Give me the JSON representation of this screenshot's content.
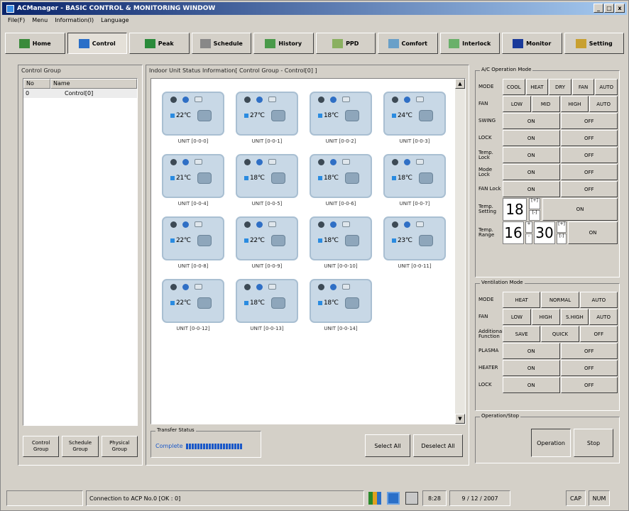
{
  "title": "ACManager - BASIC CONTROL & MONITORING WINDOW",
  "window_buttons": [
    "_",
    "□",
    "x"
  ],
  "menu": [
    "File(F)",
    "Menu",
    "Information(I)",
    "Language"
  ],
  "toolbar": [
    {
      "label": "Home",
      "icon": "home-icon",
      "color": "#3a8a3a"
    },
    {
      "label": "Control",
      "icon": "control-icon",
      "color": "#2a6fc8"
    },
    {
      "label": "Peak",
      "icon": "peak-chart-icon",
      "color": "#2a8a3a"
    },
    {
      "label": "Schedule",
      "icon": "schedule-icon",
      "color": "#888888"
    },
    {
      "label": "History",
      "icon": "history-icon",
      "color": "#4a9a4a"
    },
    {
      "label": "PPD",
      "icon": "ppd-icon",
      "color": "#8ab060"
    },
    {
      "label": "Comfort",
      "icon": "comfort-icon",
      "color": "#6aa0c8"
    },
    {
      "label": "Interlock",
      "icon": "interlock-icon",
      "color": "#6ab06a"
    },
    {
      "label": "Monitor",
      "icon": "monitor-icon",
      "color": "#1a3a9a"
    },
    {
      "label": "Setting",
      "icon": "setting-icon",
      "color": "#c8a030"
    }
  ],
  "left": {
    "title": "Control Group",
    "headers": [
      "No",
      "Name"
    ],
    "rows": [
      {
        "no": "0",
        "name": "Control[0]"
      }
    ],
    "buttons": [
      "Control Group",
      "Schedule Group",
      "Physical Group"
    ]
  },
  "center": {
    "title": "Indoor Unit Status Information[ Control Group - Control[0] ]",
    "units": [
      {
        "temp": "22℃",
        "label": "UNIT [0-0-0]"
      },
      {
        "temp": "27℃",
        "label": "UNIT [0-0-1]"
      },
      {
        "temp": "18℃",
        "label": "UNIT [0-0-2]"
      },
      {
        "temp": "24℃",
        "label": "UNIT [0-0-3]"
      },
      {
        "temp": "21℃",
        "label": "UNIT [0-0-4]"
      },
      {
        "temp": "18℃",
        "label": "UNIT [0-0-5]"
      },
      {
        "temp": "18℃",
        "label": "UNIT [0-0-6]"
      },
      {
        "temp": "18℃",
        "label": "UNIT [0-0-7]"
      },
      {
        "temp": "22℃",
        "label": "UNIT [0-0-8]"
      },
      {
        "temp": "22℃",
        "label": "UNIT [0-0-9]"
      },
      {
        "temp": "18℃",
        "label": "UNIT [0-0-10]"
      },
      {
        "temp": "23℃",
        "label": "UNIT [0-0-11]"
      },
      {
        "temp": "22℃",
        "label": "UNIT [0-0-12]"
      },
      {
        "temp": "18℃",
        "label": "UNIT [0-0-13]"
      },
      {
        "temp": "18℃",
        "label": "UNIT [0-0-14]"
      }
    ],
    "transfer_label": "Transfer Status",
    "transfer_status": "Complete",
    "select_all": "Select All",
    "deselect_all": "Deselect All"
  },
  "ac": {
    "title": "A/C Operation Mode",
    "mode_label": "MODE",
    "modes": [
      "COOL",
      "HEAT",
      "DRY",
      "FAN",
      "AUTO"
    ],
    "fan_label": "FAN",
    "fans": [
      "LOW",
      "MID",
      "HIGH",
      "AUTO"
    ],
    "swing_label": "SWING",
    "lock_label": "LOCK",
    "temp_lock_label": "Temp. Lock",
    "mode_lock_label": "Mode Lock",
    "fan_lock_label": "FAN Lock",
    "on": "ON",
    "off": "OFF",
    "temp_setting_label": "Temp. Setting",
    "temp_setting": "18",
    "temp_range_label": "Temp. Range",
    "range_low": "16",
    "range_high": "30",
    "plus": "[+]",
    "minus": "[-]"
  },
  "vent": {
    "title": "Ventilation Mode",
    "mode_label": "MODE",
    "modes": [
      "HEAT",
      "NORMAL",
      "AUTO"
    ],
    "fan_label": "FAN",
    "fans": [
      "LOW",
      "HIGH",
      "S.HIGH",
      "AUTO"
    ],
    "additional_label": "Additional Function",
    "additional": [
      "SAVE",
      "QUICK",
      "OFF"
    ],
    "plasma_label": "PLASMA",
    "heater_label": "HEATER",
    "lock_label": "LOCK"
  },
  "opstop": {
    "title": "Operation/Stop",
    "operation": "Operation",
    "stop": "Stop"
  },
  "statusbar": {
    "connection": "Connection to ACP No.0 [OK : 0]",
    "time": "8:28",
    "date": "9 / 12 / 2007",
    "cap": "CAP",
    "num": "NUM"
  }
}
